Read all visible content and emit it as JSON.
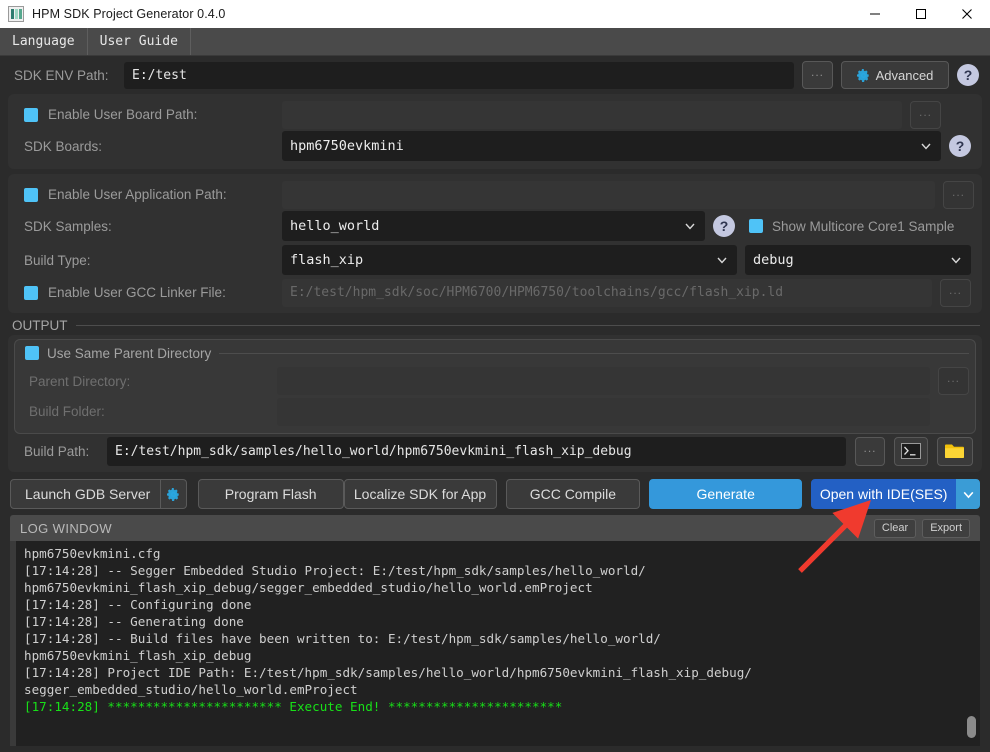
{
  "window": {
    "title": "HPM SDK Project Generator 0.4.0",
    "app_icon": "app-logo-icon",
    "minimize": "—",
    "maximize": "□",
    "close": "✕"
  },
  "menubar": {
    "items": [
      {
        "label": "Language"
      },
      {
        "label": "User Guide"
      }
    ]
  },
  "form": {
    "sdk_env": {
      "label": "SDK ENV Path:",
      "value": "E:/test",
      "browse_label": "...",
      "advanced_label": "Advanced",
      "advanced_icon": "gear-icon",
      "help_label": "?"
    },
    "user_board_path": {
      "label": "Enable User Board Path:",
      "checked": false,
      "value": "",
      "browse_label": "..."
    },
    "sdk_boards": {
      "label": "SDK Boards:",
      "value": "hpm6750evkmini",
      "help_label": "?"
    },
    "user_app_path": {
      "label": "Enable User Application Path:",
      "checked": false,
      "value": "",
      "browse_label": "..."
    },
    "sdk_samples": {
      "label": "SDK Samples:",
      "value": "hello_world",
      "help_label": "?",
      "multicore_label": "Show Multicore Core1 Sample"
    },
    "build_type": {
      "label": "Build Type:",
      "value": "flash_xip",
      "variant_value": "debug"
    },
    "gcc_linker": {
      "label": "Enable User GCC Linker File:",
      "value": "E:/test/hpm_sdk/soc/HPM6700/HPM6750/toolchains/gcc/flash_xip.ld",
      "browse_label": "..."
    }
  },
  "output": {
    "group_label": "OUTPUT",
    "same_parent_label": "Use Same Parent Directory",
    "parent_directory": {
      "label": "Parent Directory:",
      "value": "",
      "browse_label": "..."
    },
    "build_folder": {
      "label": "Build Folder:",
      "value": ""
    },
    "build_path": {
      "label": "Build Path:",
      "value": "E:/test/hpm_sdk/samples/hello_world/hpm6750evkmini_flash_xip_debug",
      "browse_label": "...",
      "terminal_icon": "terminal-icon",
      "folder_icon": "folder-icon"
    }
  },
  "actions": {
    "launch_gdb": "Launch GDB Server",
    "launch_gdb_settings_icon": "gear-icon",
    "program_flash": "Program Flash",
    "localize_sdk": "Localize SDK for App",
    "gcc_compile": "GCC Compile",
    "generate": "Generate",
    "open_with_ide": "Open with IDE(SES)",
    "open_with_ide_dropdown_icon": "chevron-down-icon"
  },
  "log": {
    "title": "LOG WINDOW",
    "clear_label": "Clear",
    "export_label": "Export",
    "lines": [
      {
        "text": "hpm6750evkmini.cfg",
        "color": "default"
      },
      {
        "text": "[17:14:28] -- Segger Embedded Studio Project: E:/test/hpm_sdk/samples/hello_world/",
        "color": "default"
      },
      {
        "text": "hpm6750evkmini_flash_xip_debug/segger_embedded_studio/hello_world.emProject",
        "color": "default"
      },
      {
        "text": "[17:14:28] -- Configuring done",
        "color": "default"
      },
      {
        "text": "[17:14:28] -- Generating done",
        "color": "default"
      },
      {
        "text": "[17:14:28] -- Build files have been written to: E:/test/hpm_sdk/samples/hello_world/",
        "color": "default"
      },
      {
        "text": "hpm6750evkmini_flash_xip_debug",
        "color": "default"
      },
      {
        "text": "[17:14:28] Project IDE Path: E:/test/hpm_sdk/samples/hello_world/hpm6750evkmini_flash_xip_debug/",
        "color": "default"
      },
      {
        "text": "segger_embedded_studio/hello_world.emProject",
        "color": "default"
      },
      {
        "text": "[17:14:28] *********************** Execute End! ***********************",
        "color": "green"
      }
    ]
  },
  "annotation": {
    "arrow": "red-pointer-arrow",
    "color": "#f03a2e"
  },
  "colors": {
    "accent_blue": "#3498db",
    "accent_blue_dark": "#2360c4",
    "checkbox_cyan": "#4fc3f7",
    "log_green": "#18e018",
    "background": "#2b2b2b",
    "panel": "#313131",
    "field": "#1e1e1e"
  }
}
